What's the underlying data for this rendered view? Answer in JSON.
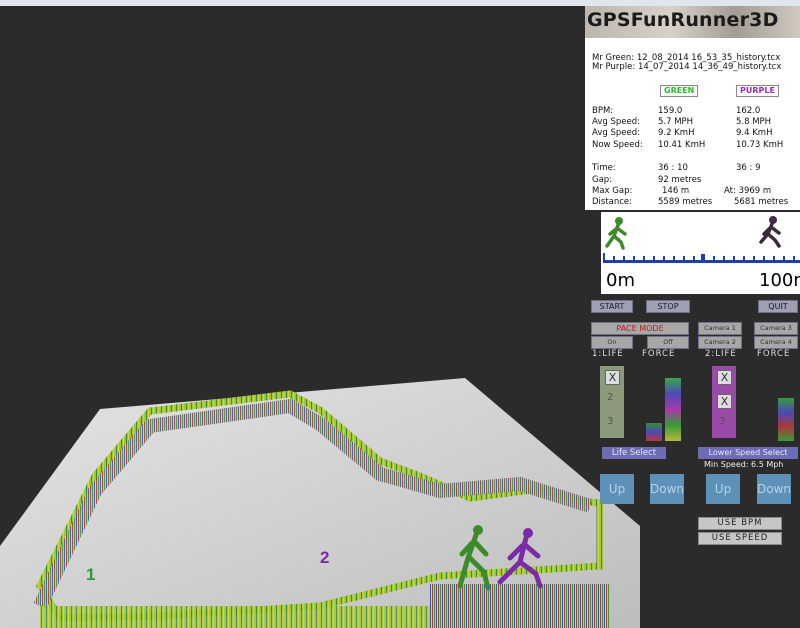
{
  "window": {
    "title": "GPSFunRunner3D"
  },
  "logo": {
    "text": "GPSFunRunner3D"
  },
  "files": {
    "green": "Mr Green: 12_08_2014 16_53_35_history.tcx",
    "purple": "Mr Purple: 14_07_2014 14_36_49_history.tcx"
  },
  "columns": {
    "green": "GREEN",
    "purple": "PURPLE",
    "green_color": "#2fb82f",
    "purple_color": "#9a2fc0"
  },
  "stats": [
    {
      "label": "BPM:",
      "green": "159.0",
      "purple": "162.0"
    },
    {
      "label": "Avg Speed:",
      "green": "5.7 MPH",
      "purple": "5.8 MPH"
    },
    {
      "label": "Avg Speed:",
      "green": "9.2 KmH",
      "purple": "9.4 KmH"
    },
    {
      "label": "Now Speed:",
      "green": "10.41 KmH",
      "purple": "10.73 KmH"
    }
  ],
  "race": [
    {
      "label": "Time:",
      "green": "36 : 10",
      "purple": "36 : 9"
    },
    {
      "label": "Gap:",
      "green": "92 metres",
      "purple": ""
    },
    {
      "label": "Max Gap:",
      "green": "146 m",
      "purple": "At: 3969 m"
    },
    {
      "label": "Distance:",
      "green": "5589 metres",
      "purple": "5681 metres"
    }
  ],
  "track": {
    "start_label": "0m",
    "end_label": "100m"
  },
  "buttons": {
    "start": "START",
    "stop": "STOP",
    "quit": "QUIT",
    "pace_mode": "PACE MODE",
    "on": "On",
    "off": "Off"
  },
  "cameras": [
    "Camera 1",
    "Camera 3",
    "Camera 2",
    "Camera 4"
  ],
  "life_headers": {
    "life1": "1:LIFE",
    "force1": "FORCE",
    "life2": "2:LIFE",
    "force2": "FORCE"
  },
  "life_numbers": {
    "two": "2",
    "three": "3",
    "x": "X"
  },
  "links": {
    "life_select": "Life Select",
    "lower_speed": "Lower Speed Select",
    "min_speed": "Min Speed: 6.5 Mph"
  },
  "arrows": {
    "up": "Up",
    "down": "Down"
  },
  "options": {
    "use_bpm": "USE BPM",
    "use_speed": "USE SPEED"
  },
  "scene": {
    "marker1": "1",
    "marker2": "2"
  }
}
